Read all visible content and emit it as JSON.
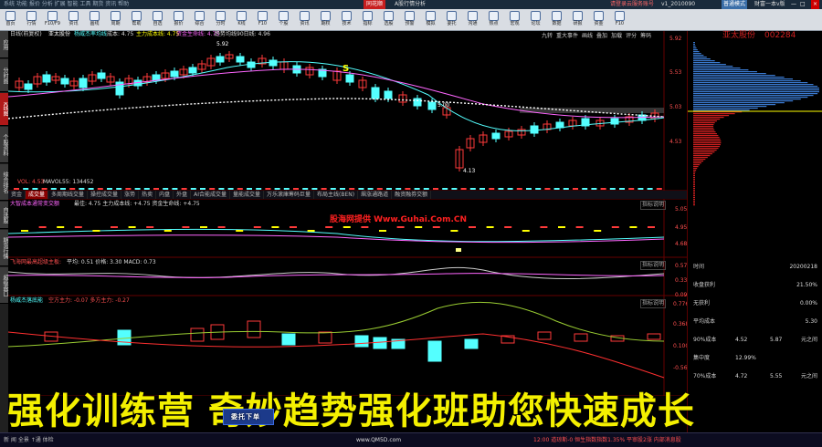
{
  "titlebar": {
    "logo": "同花顺",
    "title": "A股行情分析",
    "left_text": "系统  功能  报价  分析  扩展  智能  工具  期货  资讯  帮助",
    "right_text": "请登录云服务账号",
    "user": "v1_2010090",
    "mode": "普通模式",
    "market": "财富一本v版"
  },
  "toolbar": {
    "buttons": [
      "首页",
      "行情",
      "F10/F9",
      "资讯",
      "画线",
      "周期",
      "帮助",
      "自选",
      "报价",
      "综合",
      "分时",
      "K线",
      "F10",
      "个股",
      "资讯",
      "期权",
      "技术",
      "指标",
      "选股",
      "预警",
      "模拟",
      "委托",
      "沟通",
      "热点",
      "宏观",
      "论坛",
      "数据",
      "研报",
      "资金",
      "F10"
    ]
  },
  "sidetabs": [
    "应用",
    "分时图",
    "K线图",
    "个股资料",
    "综合排名",
    "自选股",
    "期货行情",
    "超级盘口"
  ],
  "chart": {
    "header_left": "日线(前复权)",
    "stock": "亚太股份",
    "indicator1": "杨威杰率均线",
    "ind1_val": "成本: 4.75",
    "ind2": "主力成本线: 4.75",
    "ind3": "资金生命线: 4.75",
    "ind4": "趋势均线90日线: 4.96",
    "right_tabs": [
      "九转",
      "重大事件",
      "画线",
      "叠加",
      "加载",
      "评分",
      "筹码"
    ],
    "y_labels": [
      "5.92",
      "5.53",
      "5.03",
      "4.53"
    ],
    "high_label": "5.92",
    "mid_label": "5.00",
    "low_label": "4.13",
    "s_marker": "S",
    "vol_label": "VOL:  4.53",
    "vol_ma": "MAVOL55: 134452"
  },
  "tabs": [
    "资金",
    "成交量",
    "多周期线交量",
    "操控成交量",
    "涨势",
    "热卖",
    "内盘",
    "外盘",
    "AI合能成交量",
    "量能成交量",
    "万乐滚庫筹码巨量",
    "布局主线(BEN)",
    "飙涨通路道",
    "融资融券交额"
  ],
  "active_tab_index": 1,
  "panels": {
    "p2_title": "大智成本通常变交额",
    "p2_vals": "最佳: 4.75   主力成本线: +4.75   资金生命线: +4.75",
    "p2_help": "指标说明",
    "watermark": "股海网提供  Www.Guhai.Com.CN",
    "p2_y": [
      "5.05",
      "4.95",
      "4.68"
    ],
    "p3_title": "飞海网最高超级主板:",
    "p3_vals": "平均: 0.51  价格: 3.30  MACD: 0.73",
    "p3_help": "指标说明",
    "p3_y": [
      "0.57",
      "0.33",
      "0.09"
    ],
    "p4_title": "杨威杰落底能",
    "p4_vals": "空方主力: -0.07   多方主力: -0.27",
    "p4_help": "指标说明",
    "p4_y": [
      "0.776",
      "0.368",
      "0.100",
      "-0.567"
    ]
  },
  "right_panel": {
    "name": "亚太股份",
    "code": "002284",
    "price_labels": [
      "5.92",
      "5.53",
      "5.03",
      "4.53"
    ],
    "date_label": "时间",
    "date_value": "20200218",
    "rows": [
      {
        "label": "收盘获利",
        "value": "21.50%"
      },
      {
        "label": "无获利",
        "value": "0.00%"
      },
      {
        "label": "平均成本",
        "value": "5.30"
      }
    ],
    "row90": {
      "label": "90%成本",
      "low": "4.52",
      "high": "5.87",
      "note": "元之间"
    },
    "row90b": {
      "label": "集中度",
      "value": "12.99%"
    },
    "row70": {
      "label": "70%成本",
      "low": "4.72",
      "high": "5.55",
      "note": "元之间"
    }
  },
  "banner": "强化训练营 奇妙趋势强化班助您快速成长",
  "bottom": {
    "left": "新  闻  全景  ↑通  体检",
    "order": "委托下单",
    "url": "www.QM5D.com",
    "right": "12:00  道琼斯-0  恒生指数指数1.35%  平审股2涨  内部消息股"
  },
  "colors": {
    "up": "#ff3a3a",
    "down": "#54ffff",
    "ma_white": "#e0e0e0",
    "ma_yellow": "#ffff00",
    "ma_purple": "#ff66ff",
    "accent": "#d02020",
    "banner": "#f4f000"
  }
}
